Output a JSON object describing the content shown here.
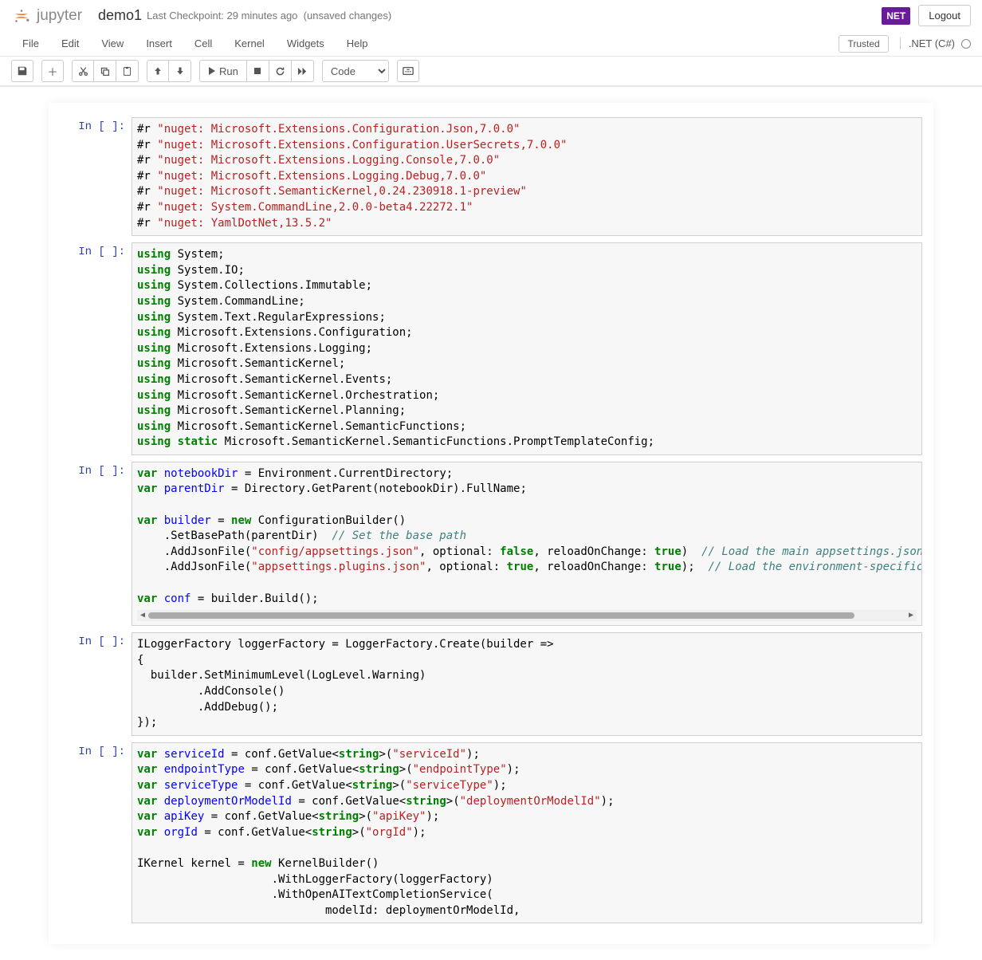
{
  "header": {
    "jupyter_text": "jupyter",
    "notebook_name": "demo1",
    "checkpoint": "Last Checkpoint: 29 minutes ago",
    "unsaved": "(unsaved changes)",
    "net_badge": "NET",
    "logout": "Logout"
  },
  "menubar": {
    "items": [
      "File",
      "Edit",
      "View",
      "Insert",
      "Cell",
      "Kernel",
      "Widgets",
      "Help"
    ],
    "trusted": "Trusted",
    "kernel_name": ".NET (C#)"
  },
  "toolbar": {
    "run_label": "Run",
    "cell_type": "Code"
  },
  "cells": [
    {
      "prompt": "In [ ]:",
      "lines": [
        [
          {
            "t": "#r ",
            "c": ""
          },
          {
            "t": "\"nuget: Microsoft.Extensions.Configuration.Json,7.0.0\"",
            "c": "cm-string"
          }
        ],
        [
          {
            "t": "#r ",
            "c": ""
          },
          {
            "t": "\"nuget: Microsoft.Extensions.Configuration.UserSecrets,7.0.0\"",
            "c": "cm-string"
          }
        ],
        [
          {
            "t": "#r ",
            "c": ""
          },
          {
            "t": "\"nuget: Microsoft.Extensions.Logging.Console,7.0.0\"",
            "c": "cm-string"
          }
        ],
        [
          {
            "t": "#r ",
            "c": ""
          },
          {
            "t": "\"nuget: Microsoft.Extensions.Logging.Debug,7.0.0\"",
            "c": "cm-string"
          }
        ],
        [
          {
            "t": "#r ",
            "c": ""
          },
          {
            "t": "\"nuget: Microsoft.SemanticKernel,0.24.230918.1-preview\"",
            "c": "cm-string"
          }
        ],
        [
          {
            "t": "#r ",
            "c": ""
          },
          {
            "t": "\"nuget: System.CommandLine,2.0.0-beta4.22272.1\"",
            "c": "cm-string"
          }
        ],
        [
          {
            "t": "#r ",
            "c": ""
          },
          {
            "t": "\"nuget: YamlDotNet,13.5.2\"",
            "c": "cm-string"
          }
        ]
      ]
    },
    {
      "prompt": "In [ ]:",
      "lines": [
        [
          {
            "t": "using",
            "c": "cm-keyword"
          },
          {
            "t": " System;",
            "c": ""
          }
        ],
        [
          {
            "t": "using",
            "c": "cm-keyword"
          },
          {
            "t": " System.IO;",
            "c": ""
          }
        ],
        [
          {
            "t": "using",
            "c": "cm-keyword"
          },
          {
            "t": " System.Collections.Immutable;",
            "c": ""
          }
        ],
        [
          {
            "t": "using",
            "c": "cm-keyword"
          },
          {
            "t": " System.CommandLine;",
            "c": ""
          }
        ],
        [
          {
            "t": "using",
            "c": "cm-keyword"
          },
          {
            "t": " System.Text.RegularExpressions;",
            "c": ""
          }
        ],
        [
          {
            "t": "using",
            "c": "cm-keyword"
          },
          {
            "t": " Microsoft.Extensions.Configuration;",
            "c": ""
          }
        ],
        [
          {
            "t": "using",
            "c": "cm-keyword"
          },
          {
            "t": " Microsoft.Extensions.Logging;",
            "c": ""
          }
        ],
        [
          {
            "t": "using",
            "c": "cm-keyword"
          },
          {
            "t": " Microsoft.SemanticKernel;",
            "c": ""
          }
        ],
        [
          {
            "t": "using",
            "c": "cm-keyword"
          },
          {
            "t": " Microsoft.SemanticKernel.Events;",
            "c": ""
          }
        ],
        [
          {
            "t": "using",
            "c": "cm-keyword"
          },
          {
            "t": " Microsoft.SemanticKernel.Orchestration;",
            "c": ""
          }
        ],
        [
          {
            "t": "using",
            "c": "cm-keyword"
          },
          {
            "t": " Microsoft.SemanticKernel.Planning;",
            "c": ""
          }
        ],
        [
          {
            "t": "using",
            "c": "cm-keyword"
          },
          {
            "t": " Microsoft.SemanticKernel.SemanticFunctions;",
            "c": ""
          }
        ],
        [
          {
            "t": "using",
            "c": "cm-keyword"
          },
          {
            "t": " ",
            "c": ""
          },
          {
            "t": "static",
            "c": "cm-keyword"
          },
          {
            "t": " Microsoft.SemanticKernel.SemanticFunctions.PromptTemplateConfig;",
            "c": ""
          }
        ]
      ]
    },
    {
      "prompt": "In [ ]:",
      "has_scrollbar": true,
      "has_cursor": true,
      "cursor_line": 1,
      "lines": [
        [
          {
            "t": "var",
            "c": "cm-keyword"
          },
          {
            "t": " ",
            "c": ""
          },
          {
            "t": "notebookDir",
            "c": "cm-def"
          },
          {
            "t": " = Environment.CurrentDirectory;",
            "c": ""
          }
        ],
        [
          {
            "t": "var",
            "c": "cm-keyword"
          },
          {
            "t": " ",
            "c": ""
          },
          {
            "t": "parentDir",
            "c": "cm-def"
          },
          {
            "t": " = Directory.GetParent(notebookDir).FullName;",
            "c": ""
          }
        ],
        [
          {
            "t": "",
            "c": ""
          }
        ],
        [
          {
            "t": "var",
            "c": "cm-keyword"
          },
          {
            "t": " ",
            "c": ""
          },
          {
            "t": "builder",
            "c": "cm-def"
          },
          {
            "t": " = ",
            "c": ""
          },
          {
            "t": "new",
            "c": "cm-keyword"
          },
          {
            "t": " ConfigurationBuilder()",
            "c": ""
          }
        ],
        [
          {
            "t": "    .SetBasePath(parentDir)  ",
            "c": ""
          },
          {
            "t": "// Set the base path",
            "c": "cm-comment"
          }
        ],
        [
          {
            "t": "    .AddJsonFile(",
            "c": ""
          },
          {
            "t": "\"config/appsettings.json\"",
            "c": "cm-string"
          },
          {
            "t": ", optional: ",
            "c": ""
          },
          {
            "t": "false",
            "c": "cm-atom"
          },
          {
            "t": ", reloadOnChange: ",
            "c": ""
          },
          {
            "t": "true",
            "c": "cm-atom"
          },
          {
            "t": ")  ",
            "c": ""
          },
          {
            "t": "// Load the main appsettings.json file",
            "c": "cm-comment"
          }
        ],
        [
          {
            "t": "    .AddJsonFile(",
            "c": ""
          },
          {
            "t": "\"appsettings.plugins.json\"",
            "c": "cm-string"
          },
          {
            "t": ", optional: ",
            "c": ""
          },
          {
            "t": "true",
            "c": "cm-atom"
          },
          {
            "t": ", reloadOnChange: ",
            "c": ""
          },
          {
            "t": "true",
            "c": "cm-atom"
          },
          {
            "t": ");  ",
            "c": ""
          },
          {
            "t": "// Load the environment-specific appsettings",
            "c": "cm-comment"
          }
        ],
        [
          {
            "t": "",
            "c": ""
          }
        ],
        [
          {
            "t": "var",
            "c": "cm-keyword"
          },
          {
            "t": " ",
            "c": ""
          },
          {
            "t": "conf",
            "c": "cm-def"
          },
          {
            "t": " = builder.Build();",
            "c": ""
          }
        ]
      ]
    },
    {
      "prompt": "In [ ]:",
      "lines": [
        [
          {
            "t": "ILoggerFactory loggerFactory = LoggerFactory.Create(builder =>",
            "c": ""
          }
        ],
        [
          {
            "t": "{",
            "c": ""
          }
        ],
        [
          {
            "t": "  builder.SetMinimumLevel(LogLevel.Warning)",
            "c": ""
          }
        ],
        [
          {
            "t": "         .AddConsole()",
            "c": ""
          }
        ],
        [
          {
            "t": "         .AddDebug();",
            "c": ""
          }
        ],
        [
          {
            "t": "});",
            "c": ""
          }
        ]
      ]
    },
    {
      "prompt": "In [ ]:",
      "lines": [
        [
          {
            "t": "var",
            "c": "cm-keyword"
          },
          {
            "t": " ",
            "c": ""
          },
          {
            "t": "serviceId",
            "c": "cm-def"
          },
          {
            "t": " = conf.GetValue<",
            "c": ""
          },
          {
            "t": "string",
            "c": "cm-keyword"
          },
          {
            "t": ">(",
            "c": ""
          },
          {
            "t": "\"serviceId\"",
            "c": "cm-string"
          },
          {
            "t": ");",
            "c": ""
          }
        ],
        [
          {
            "t": "var",
            "c": "cm-keyword"
          },
          {
            "t": " ",
            "c": ""
          },
          {
            "t": "endpointType",
            "c": "cm-def"
          },
          {
            "t": " = conf.GetValue<",
            "c": ""
          },
          {
            "t": "string",
            "c": "cm-keyword"
          },
          {
            "t": ">(",
            "c": ""
          },
          {
            "t": "\"endpointType\"",
            "c": "cm-string"
          },
          {
            "t": ");",
            "c": ""
          }
        ],
        [
          {
            "t": "var",
            "c": "cm-keyword"
          },
          {
            "t": " ",
            "c": ""
          },
          {
            "t": "serviceType",
            "c": "cm-def"
          },
          {
            "t": " = conf.GetValue<",
            "c": ""
          },
          {
            "t": "string",
            "c": "cm-keyword"
          },
          {
            "t": ">(",
            "c": ""
          },
          {
            "t": "\"serviceType\"",
            "c": "cm-string"
          },
          {
            "t": ");",
            "c": ""
          }
        ],
        [
          {
            "t": "var",
            "c": "cm-keyword"
          },
          {
            "t": " ",
            "c": ""
          },
          {
            "t": "deploymentOrModelId",
            "c": "cm-def"
          },
          {
            "t": " = conf.GetValue<",
            "c": ""
          },
          {
            "t": "string",
            "c": "cm-keyword"
          },
          {
            "t": ">(",
            "c": ""
          },
          {
            "t": "\"deploymentOrModelId\"",
            "c": "cm-string"
          },
          {
            "t": ");",
            "c": ""
          }
        ],
        [
          {
            "t": "var",
            "c": "cm-keyword"
          },
          {
            "t": " ",
            "c": ""
          },
          {
            "t": "apiKey",
            "c": "cm-def"
          },
          {
            "t": " = conf.GetValue<",
            "c": ""
          },
          {
            "t": "string",
            "c": "cm-keyword"
          },
          {
            "t": ">(",
            "c": ""
          },
          {
            "t": "\"apiKey\"",
            "c": "cm-string"
          },
          {
            "t": ");",
            "c": ""
          }
        ],
        [
          {
            "t": "var",
            "c": "cm-keyword"
          },
          {
            "t": " ",
            "c": ""
          },
          {
            "t": "orgId",
            "c": "cm-def"
          },
          {
            "t": " = conf.GetValue<",
            "c": ""
          },
          {
            "t": "string",
            "c": "cm-keyword"
          },
          {
            "t": ">(",
            "c": ""
          },
          {
            "t": "\"orgId\"",
            "c": "cm-string"
          },
          {
            "t": ");",
            "c": ""
          }
        ],
        [
          {
            "t": "",
            "c": ""
          }
        ],
        [
          {
            "t": "IKernel kernel = ",
            "c": ""
          },
          {
            "t": "new",
            "c": "cm-keyword"
          },
          {
            "t": " KernelBuilder()",
            "c": ""
          }
        ],
        [
          {
            "t": "                    .WithLoggerFactory(loggerFactory)",
            "c": ""
          }
        ],
        [
          {
            "t": "                    .WithOpenAITextCompletionService(",
            "c": ""
          }
        ],
        [
          {
            "t": "                            modelId: deploymentOrModelId,",
            "c": ""
          }
        ]
      ]
    }
  ]
}
